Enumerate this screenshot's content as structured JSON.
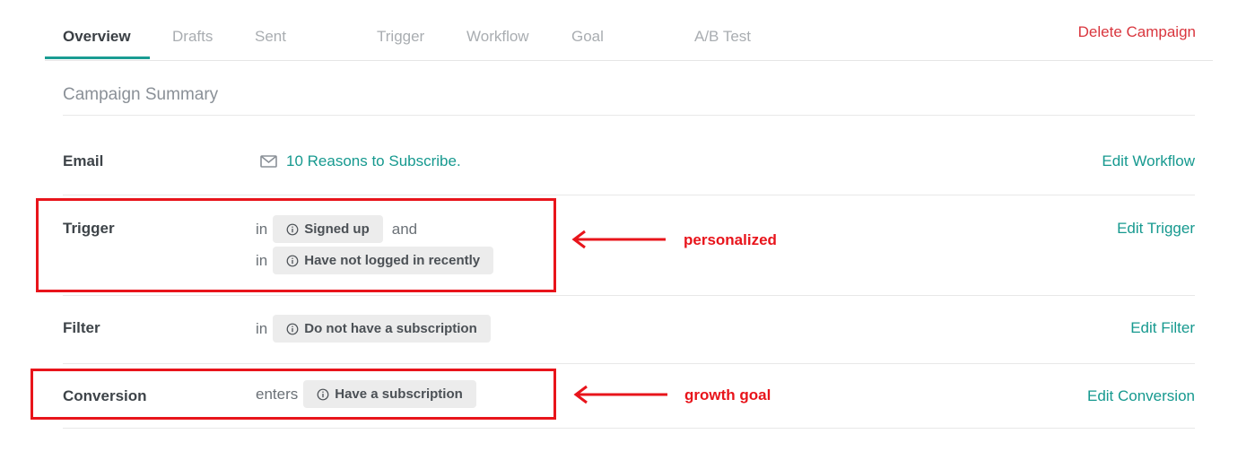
{
  "tabs": {
    "overview": "Overview",
    "drafts": "Drafts",
    "sent": "Sent",
    "trigger": "Trigger",
    "workflow": "Workflow",
    "goal": "Goal",
    "ab_test": "A/B Test",
    "active": "Overview"
  },
  "header": {
    "delete_label": "Delete Campaign"
  },
  "summary": {
    "title": "Campaign Summary",
    "rows": {
      "email": {
        "label": "Email",
        "icon": "mail-icon",
        "value": "10 Reasons to Subscribe.",
        "action": "Edit Workflow"
      },
      "trigger": {
        "label": "Trigger",
        "conditions": [
          {
            "prefix": "in",
            "segment": "Signed up",
            "conjunction": "and"
          },
          {
            "prefix": "in",
            "segment": "Have not logged in recently"
          }
        ],
        "action": "Edit Trigger"
      },
      "filter": {
        "label": "Filter",
        "prefix": "in",
        "segment": "Do not have a subscription",
        "action": "Edit Filter"
      },
      "conversion": {
        "label": "Conversion",
        "prefix": "enters",
        "segment": "Have a subscription",
        "action": "Edit Conversion"
      }
    }
  },
  "annotations": {
    "trigger_note": "personalized",
    "conversion_note": "growth goal",
    "color": "#e8141b"
  },
  "colors": {
    "accent": "#16998f",
    "danger": "#d9363e",
    "pill_bg": "#ececec"
  }
}
